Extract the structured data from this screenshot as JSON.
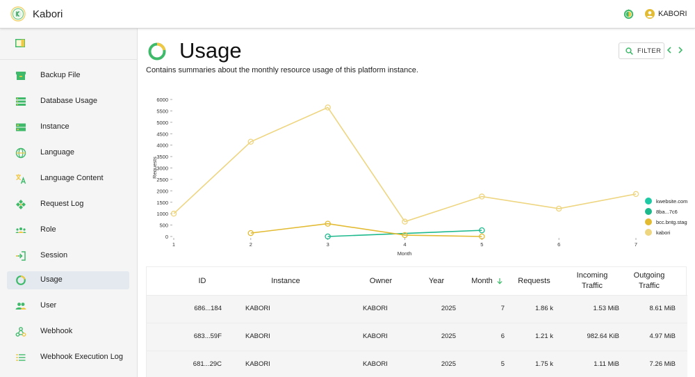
{
  "app": {
    "title": "Kabori",
    "user_name": "KABORI"
  },
  "colors": {
    "accent_green": "#3fba6b",
    "accent_yellow": "#f0c843",
    "series_1": "#1fc9a4",
    "series_2": "#1db98d",
    "series_3": "#e3bb33",
    "series_4": "#eed580"
  },
  "sidebar": {
    "items": [
      {
        "label": "Backup File",
        "icon": "backup-file-icon"
      },
      {
        "label": "Database Usage",
        "icon": "database-icon"
      },
      {
        "label": "Instance",
        "icon": "instance-icon"
      },
      {
        "label": "Language",
        "icon": "globe-icon"
      },
      {
        "label": "Language Content",
        "icon": "translate-icon"
      },
      {
        "label": "Request Log",
        "icon": "request-log-icon"
      },
      {
        "label": "Role",
        "icon": "role-icon"
      },
      {
        "label": "Session",
        "icon": "login-icon"
      },
      {
        "label": "Usage",
        "icon": "usage-ring-icon",
        "active": true
      },
      {
        "label": "User",
        "icon": "user-group-icon"
      },
      {
        "label": "Webhook",
        "icon": "webhook-icon"
      },
      {
        "label": "Webhook Execution Log",
        "icon": "list-icon"
      }
    ]
  },
  "page": {
    "title": "Usage",
    "description": "Contains summaries about the monthly resource usage of this platform instance.",
    "filter_label": "FILTER"
  },
  "chart_data": {
    "type": "line",
    "xlabel": "Month",
    "ylabel": "Requests",
    "x": [
      1,
      2,
      3,
      4,
      5,
      6,
      7
    ],
    "xlim": [
      1,
      7
    ],
    "ylim": [
      0,
      6000
    ],
    "yticks": [
      0,
      500,
      1000,
      1500,
      2000,
      2500,
      3000,
      3500,
      4000,
      4500,
      5000,
      5500,
      6000
    ],
    "legend_position": "right",
    "grid": false,
    "series": [
      {
        "name": "kwebsite.com",
        "color": "#1fc9a4",
        "points": []
      },
      {
        "name": "8ba...7c6",
        "color": "#1db98d",
        "points": [
          [
            3,
            0
          ],
          [
            5,
            270
          ]
        ]
      },
      {
        "name": "bcc.bntg.stag",
        "color": "#e3bb33",
        "points": [
          [
            2,
            150
          ],
          [
            3,
            560
          ],
          [
            4,
            60
          ],
          [
            5,
            0
          ]
        ]
      },
      {
        "name": "kabori",
        "color": "#eed580",
        "points": [
          [
            1,
            1000
          ],
          [
            2,
            4150
          ],
          [
            3,
            5650
          ],
          [
            4,
            650
          ],
          [
            5,
            1750
          ],
          [
            6,
            1220
          ],
          [
            7,
            1860
          ]
        ]
      }
    ]
  },
  "table": {
    "columns": [
      "ID",
      "Instance",
      "Owner",
      "Year",
      "Month",
      "Requests",
      "Incoming Traffic",
      "Outgoing Traffic"
    ],
    "rows": [
      {
        "id": "686...184",
        "instance": "KABORI",
        "owner": "KABORI",
        "year": "2025",
        "month": "7",
        "requests": "1.86 k",
        "incoming": "1.53 MiB",
        "outgoing": "8.61 MiB"
      },
      {
        "id": "683...59F",
        "instance": "KABORI",
        "owner": "KABORI",
        "year": "2025",
        "month": "6",
        "requests": "1.21 k",
        "incoming": "982.64 KiB",
        "outgoing": "4.97 MiB"
      },
      {
        "id": "681...29C",
        "instance": "KABORI",
        "owner": "KABORI",
        "year": "2025",
        "month": "5",
        "requests": "1.75 k",
        "incoming": "1.11 MiB",
        "outgoing": "7.26 MiB"
      }
    ]
  }
}
